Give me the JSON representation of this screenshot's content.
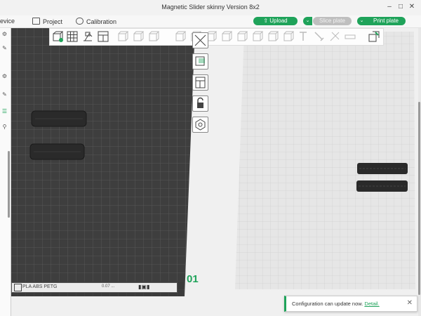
{
  "window": {
    "title": "Magnetic Slider skinny Version 8x2"
  },
  "menu": {
    "device": "evice",
    "project": "Project",
    "calibration": "Calibration"
  },
  "actions": {
    "upload": "Upload",
    "slice": "Slice plate",
    "print": "Print plate"
  },
  "plate": {
    "label": "01",
    "filament_label": "PLA ABS PETG",
    "info": "0.07 ..."
  },
  "toast": {
    "message": "Configuration can update now.",
    "link": "Detail."
  },
  "colors": {
    "accent": "#1fa35a"
  },
  "icons": {
    "toolbar": [
      "add-box-icon",
      "grid-arrange-icon",
      "orient-icon",
      "layout-plate-icon",
      "cube-icon",
      "cube-icon",
      "cube-icon",
      "cube-icon",
      "cube-icon",
      "cube-icon",
      "text-icon",
      "paint-brush-icon",
      "support-paint-icon",
      "seam-icon",
      "measure-icon",
      "assemble-icon"
    ],
    "side": [
      "layers-icon",
      "auto-orient-icon",
      "arrange-icon",
      "lock-icon",
      "settings-hex-icon"
    ]
  }
}
